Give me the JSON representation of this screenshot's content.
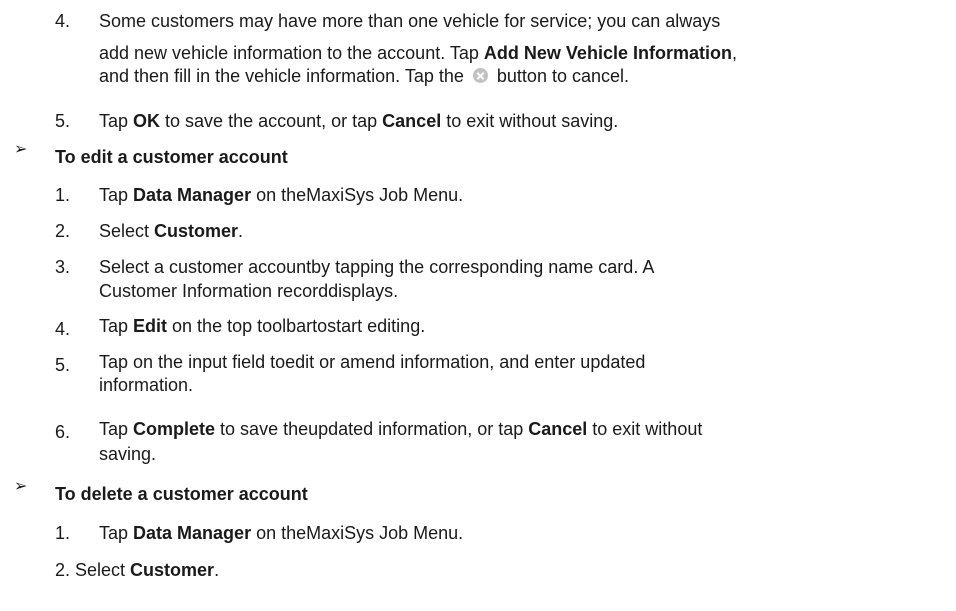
{
  "steps_top": {
    "s4": {
      "num": "4.",
      "line1": "Some customers may have more than one vehicle for service; you can always",
      "a": "add new vehicle information to the account. Tap ",
      "b1": "Add New Vehicle Information",
      "c": ",",
      "line3a": "and then fill in the vehicle information. Tap the ",
      "line3b": " button to cancel.",
      "icon": "cancel-circle-icon"
    },
    "s5": {
      "num": "5.",
      "a": "Tap ",
      "b1": "OK",
      "c": " to save the account, or tap ",
      "b2": "Cancel",
      "d": " to exit without saving."
    }
  },
  "edit": {
    "arrow": "➢",
    "heading": "To edit a customer account",
    "s1": {
      "num": "1.",
      "a": "Tap ",
      "b1": "Data Manager",
      "c": " on theMaxiSys Job Menu."
    },
    "s2": {
      "num": "2.",
      "a": "Select ",
      "b1": "Customer",
      "c": "."
    },
    "s3": {
      "num": "3.",
      "line1": "Select a customer accountby tapping the corresponding name card. A",
      "line2": "Customer Information recorddisplays."
    },
    "s4": {
      "num": "4.",
      "a": "Tap ",
      "b1": "Edit",
      "c": " on the top toolbartostart editing."
    },
    "s5": {
      "num": "5.",
      "line1": "Tap on the input field toedit or amend information, and enter updated",
      "line2": "information."
    },
    "s6": {
      "num": "6.",
      "a": "Tap ",
      "b1": "Complete",
      "c": " to save theupdated information, or tap ",
      "b2": "Cancel",
      "d": " to exit without",
      "line2": "saving."
    }
  },
  "delete": {
    "arrow": "➢",
    "heading": "To delete a customer account",
    "s1": {
      "num": "1.",
      "a": "Tap ",
      "b1": "Data Manager",
      "c": " on theMaxiSys Job Menu."
    },
    "s2": {
      "text": "2. Select ",
      "b1": "Customer",
      "c": "."
    }
  }
}
